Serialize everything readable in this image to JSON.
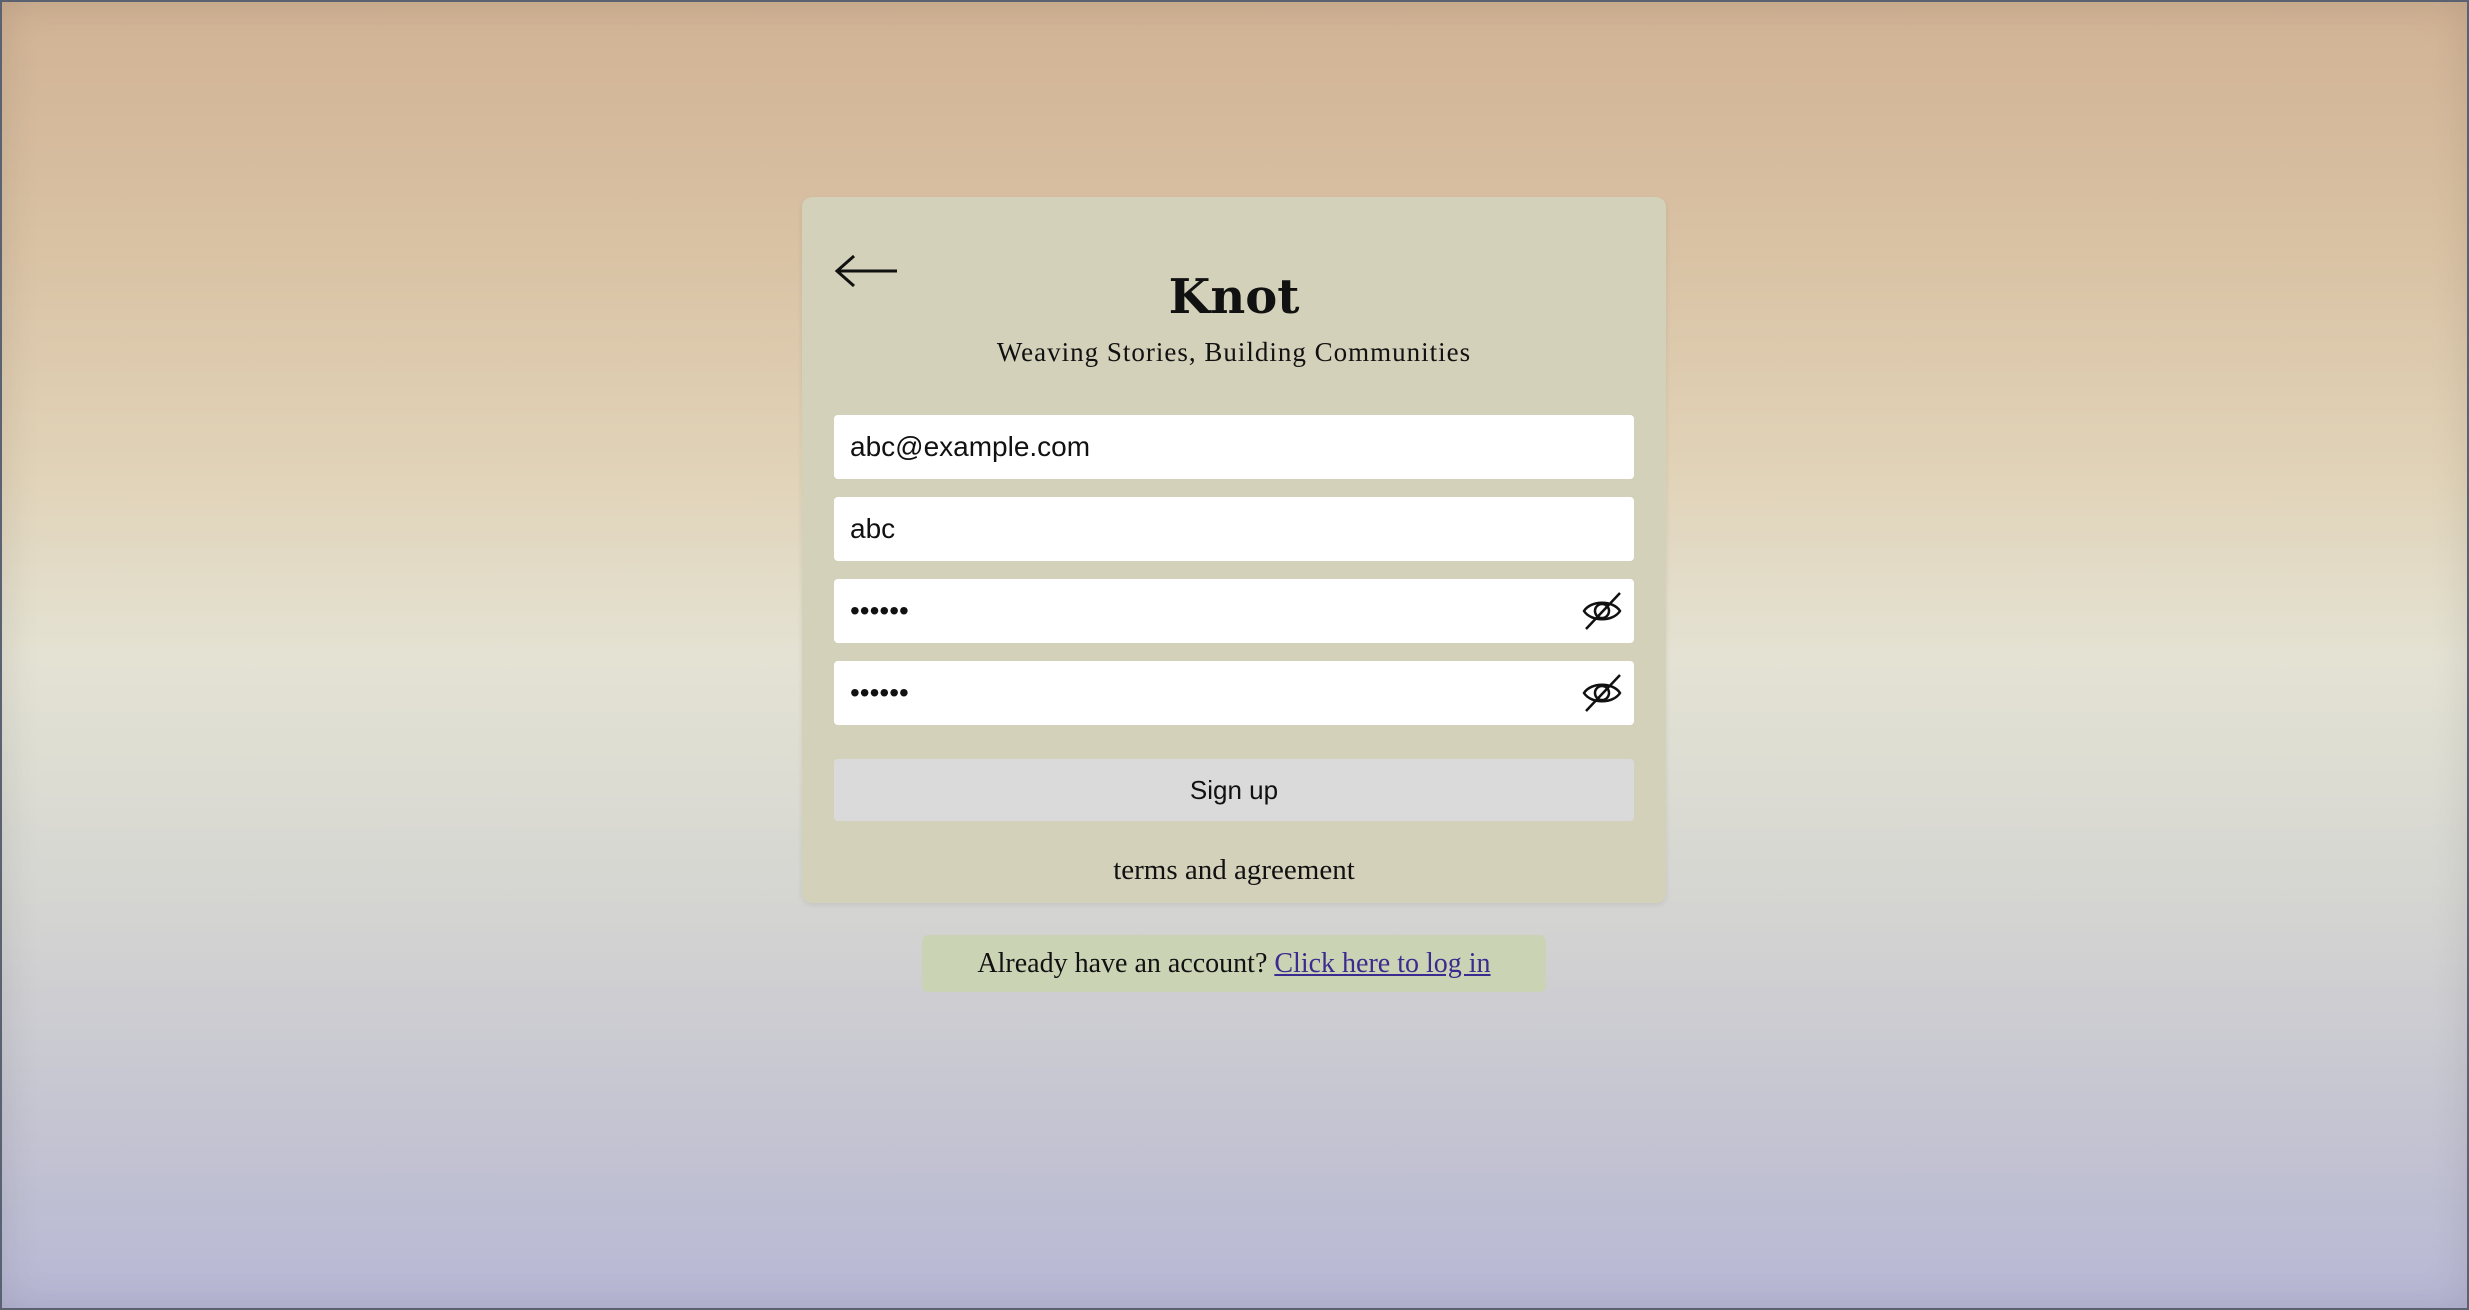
{
  "app": {
    "title": "Knot",
    "tagline": "Weaving Stories, Building Communities"
  },
  "form": {
    "email": {
      "value": "abc@example.com"
    },
    "username": {
      "value": "abc"
    },
    "password": {
      "value": "••••••",
      "toggle_icon": "eye-off-icon"
    },
    "confirm_password": {
      "value": "••••••",
      "toggle_icon": "eye-off-icon"
    },
    "submit_label": "Sign up",
    "terms_label": "terms and agreement"
  },
  "footer": {
    "prompt": "Already have an account?",
    "login_link": "Click here to log in"
  },
  "nav": {
    "back_icon": "arrow-left-icon"
  },
  "colors": {
    "card": "#d3d1ba",
    "login_box": "#cbd3b5",
    "button": "#dadada",
    "link": "#3b2a8f"
  }
}
